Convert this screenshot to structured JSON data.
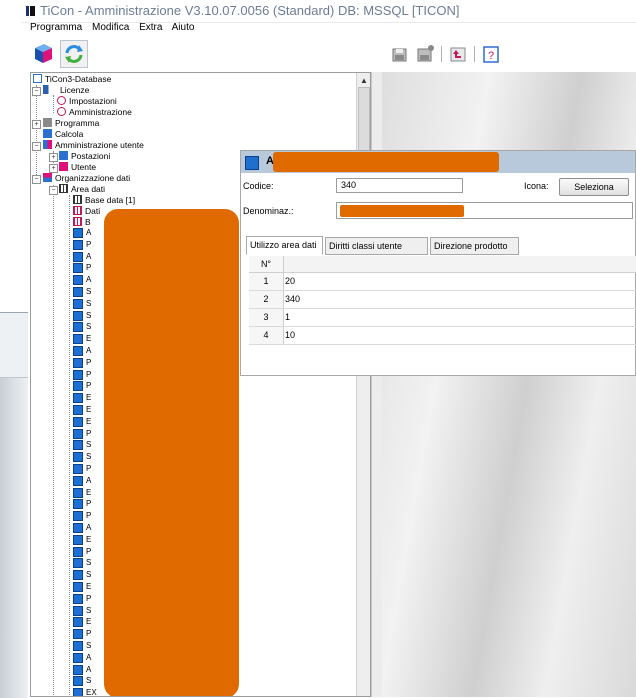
{
  "window": {
    "title": "TiCon - Amministrazione V3.10.07.0056 (Standard) DB: MSSQL [TICON]"
  },
  "menu": [
    "Programma",
    "Modifica",
    "Extra",
    "Aiuto"
  ],
  "toolbar": {
    "left_icons": [
      "cube-icon",
      "refresh-icon"
    ],
    "right_icons": [
      "save-icon",
      "save-as-icon",
      "undo-icon",
      "help-icon"
    ]
  },
  "tree": {
    "root": "TiCon3-Database",
    "nodes": [
      {
        "label": "Licenze",
        "icon": "key-icon"
      },
      {
        "label": "Impostazioni",
        "icon": "license-icon"
      },
      {
        "label": "Amministrazione",
        "icon": "license-icon"
      },
      {
        "label": "Programma",
        "icon": "program-icon"
      },
      {
        "label": "Calcola",
        "icon": "calculator-icon"
      },
      {
        "label": "Amministrazione utente",
        "icon": "users-icon"
      },
      {
        "label": "Postazioni",
        "icon": "workstation-icon"
      },
      {
        "label": "Utente",
        "icon": "user-icon"
      },
      {
        "label": "Organizzazione dati",
        "icon": "organization-icon"
      },
      {
        "label": "Area dati",
        "icon": "grid-icon"
      },
      {
        "label": "Base data [1]",
        "icon": "grid-icon"
      },
      {
        "label": "Dati",
        "icon": "grid-icon"
      }
    ],
    "leaf_letters": [
      "A",
      "P",
      "A",
      "P",
      "A",
      "S",
      "S",
      "S",
      "S",
      "E",
      "A",
      "P",
      "P",
      "P",
      "E",
      "E",
      "E",
      "P",
      "S",
      "S",
      "P",
      "A",
      "E",
      "P",
      "P",
      "A",
      "E",
      "P",
      "S",
      "S",
      "E",
      "P",
      "S",
      "E",
      "P",
      "S",
      "A",
      "A",
      "S"
    ],
    "last_item": "EX"
  },
  "dialog": {
    "title_prefix": "A",
    "codice_label": "Codice:",
    "codice_value": "340",
    "icona_label": "Icona:",
    "seleziona_label": "Seleziona",
    "denominaz_label": "Denominaz.:",
    "tabs": [
      "Utilizzo area dati",
      "Diritti classi utente",
      "Direzione prodotto"
    ],
    "grid_header": "N°",
    "rows": [
      {
        "n": "1",
        "value": "20"
      },
      {
        "n": "2",
        "value": "340"
      },
      {
        "n": "3",
        "value": "1"
      },
      {
        "n": "4",
        "value": "10"
      }
    ]
  },
  "colors": {
    "redaction": "#e06a00",
    "accent": "#1f6fcf",
    "title_text": "#6d7c94"
  }
}
